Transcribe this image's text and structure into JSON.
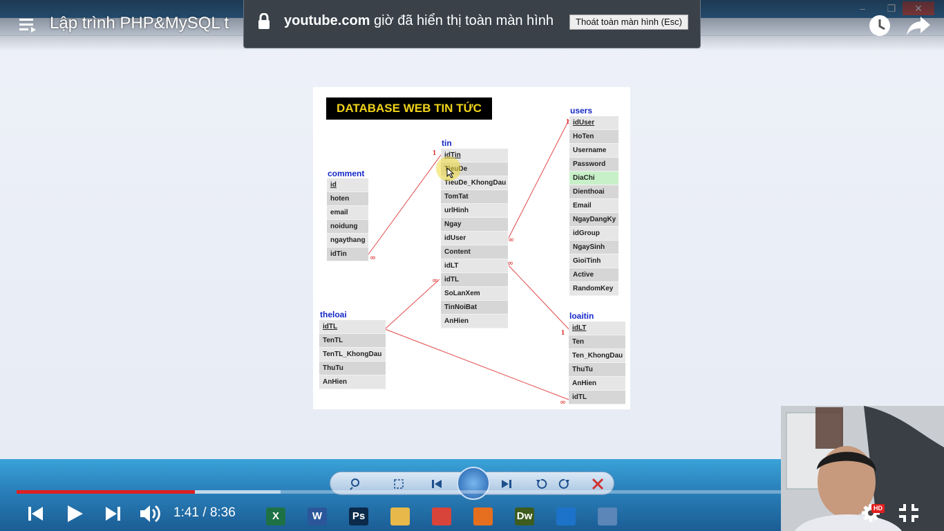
{
  "player": {
    "title": "Lập trình PHP&MySQL t",
    "time_current": "1:41",
    "time_separator": " / ",
    "time_total": "8:36",
    "progress_fraction": 0.196,
    "buffer_fraction": 0.29,
    "hd_badge": "HD",
    "colors": {
      "progress": "#e01f1f"
    }
  },
  "fullscreen_notice": {
    "domain": "youtube.com",
    "message": " giờ đã hiển thị toàn màn hình",
    "exit_button": "Thoát toàn màn hình (Esc)"
  },
  "diagram": {
    "title": "DATABASE WEB TIN TỨC",
    "tables": {
      "tin": {
        "name": "tin",
        "fields": [
          "idTin",
          "TieuDe",
          "TieuDe_KhongDau",
          "TomTat",
          "urlHinh",
          "Ngay",
          "idUser",
          "Content",
          "idLT",
          "idTL",
          "SoLanXem",
          "TinNoiBat",
          "AnHien"
        ]
      },
      "users": {
        "name": "users",
        "fields": [
          "idUser",
          "HoTen",
          "Username",
          "Password",
          "DiaChi",
          "Dienthoai",
          "Email",
          "NgayDangKy",
          "idGroup",
          "NgaySinh",
          "GioiTinh",
          "Active",
          "RandomKey"
        ]
      },
      "comment": {
        "name": "comment",
        "fields": [
          "id",
          "hoten",
          "email",
          "noidung",
          "ngaythang",
          "idTin"
        ]
      },
      "theloai": {
        "name": "theloai",
        "fields": [
          "idTL",
          "TenTL",
          "TenTL_KhongDau",
          "ThuTu",
          "AnHien"
        ]
      },
      "loaitin": {
        "name": "loaitin",
        "fields": [
          "idLT",
          "Ten",
          "Ten_KhongDau",
          "ThuTu",
          "AnHien",
          "idTL"
        ]
      }
    },
    "cardinality": {
      "one": "1",
      "many": "∞"
    }
  },
  "taskbar": {
    "apps": [
      {
        "name": "excel",
        "letter": "X",
        "color": "#1e7145"
      },
      {
        "name": "word",
        "letter": "W",
        "color": "#2b579a"
      },
      {
        "name": "photoshop",
        "letter": "Ps",
        "color": "#0b2a4a"
      },
      {
        "name": "file-explorer",
        "letter": "",
        "color": "#e8b84a"
      },
      {
        "name": "chrome",
        "letter": "",
        "color": "#d9443a"
      },
      {
        "name": "firefox",
        "letter": "",
        "color": "#e66f1f"
      },
      {
        "name": "dreamweaver",
        "letter": "Dw",
        "color": "#3d5c1e"
      },
      {
        "name": "teamviewer",
        "letter": "",
        "color": "#1d73c9"
      },
      {
        "name": "photo-viewer",
        "letter": "",
        "color": "#5c86b8"
      }
    ]
  }
}
